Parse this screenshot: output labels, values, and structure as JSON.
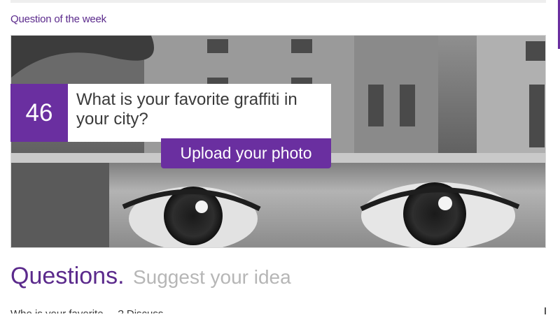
{
  "header": {
    "section_label": "Question of the week"
  },
  "featured_question": {
    "number": "46",
    "text": "What is your favorite graffiti in your city?",
    "upload_label": "Upload your photo",
    "image_description_hidden": true
  },
  "questions_section": {
    "title": "Questions.",
    "suggest_link": "Suggest your idea",
    "partial_line": "Who is your favorite ... ? Discuss"
  },
  "colors": {
    "brand_purple": "#6a2fa0",
    "heading_purple": "#5b2a8c",
    "muted_gray": "#b6b6b6"
  }
}
